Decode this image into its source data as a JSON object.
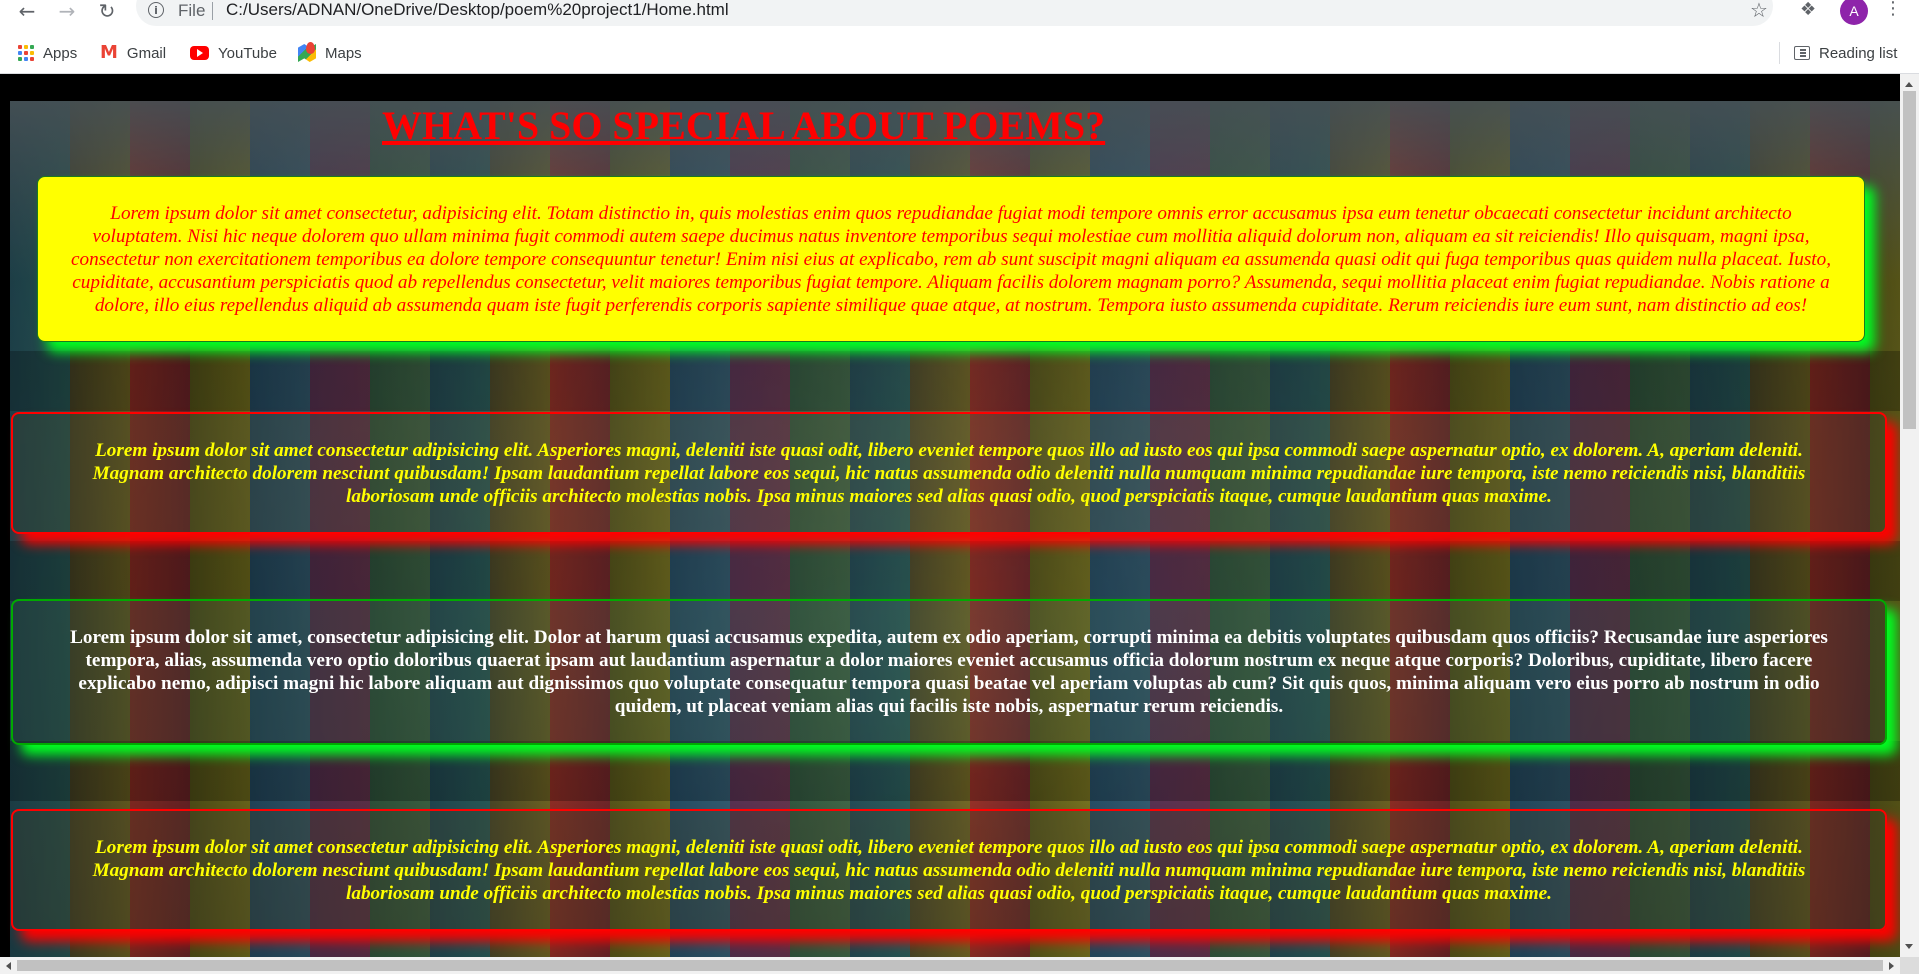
{
  "browser": {
    "scheme_label": "File",
    "url": "C:/Users/ADNAN/OneDrive/Desktop/poem%20project1/Home.html",
    "profile_initial": "A",
    "icons": {
      "back": "arrow-left-icon",
      "forward": "arrow-right-icon",
      "reload": "reload-icon",
      "info": "info-icon",
      "bookmark_star": "star-icon",
      "extensions": "puzzle-icon",
      "menu": "kebab-menu-icon"
    }
  },
  "bookmarks": {
    "apps": "Apps",
    "gmail": "Gmail",
    "youtube": "YouTube",
    "maps": "Maps",
    "reading_list": "Reading list"
  },
  "page": {
    "title": "WHAT'S SO SPECIAL ABOUT POEMS?",
    "colors": {
      "title": "#ff0000",
      "box1_bg": "#ffff00",
      "box1_text": "#ff0000",
      "green_glow": "#00ff22",
      "red_glow": "#ff0000",
      "yellow_text": "#ffff00",
      "white_text": "#ffffff"
    },
    "boxes": [
      {
        "text": "Lorem ipsum dolor sit amet consectetur, adipisicing elit. Totam distinctio in, quis molestias enim quos repudiandae fugiat modi tempore omnis error accusamus ipsa eum tenetur obcaecati consectetur incidunt architecto voluptatem. Nisi hic neque dolorem quo ullam minima fugit commodi autem saepe ducimus natus inventore temporibus sequi molestiae cum mollitia aliquid dolorum non, aliquam ea sit reiciendis! Illo quisquam, magni ipsa, consectetur non exercitationem temporibus ea dolore tempore consequuntur tenetur! Enim nisi eius at explicabo, rem ab sunt suscipit magni aliquam ea assumenda quasi odit qui fuga temporibus quas quidem nulla placeat. Iusto, cupiditate, accusantium perspiciatis quod ab repellendus consectetur, velit maiores temporibus fugiat tempore. Aliquam facilis dolorem magnam porro? Assumenda, sequi mollitia placeat enim fugiat repudiandae. Nobis ratione a dolore, illo eius repellendus aliquid ab assumenda quam iste fugit perferendis corporis sapiente similique quae atque, at nostrum. Tempora iusto assumenda cupiditate. Rerum reiciendis iure eum sunt, nam distinctio ad eos!"
      },
      {
        "text": "Lorem ipsum dolor sit amet consectetur adipisicing elit. Asperiores magni, deleniti iste quasi odit, libero eveniet tempore quos illo ad iusto eos qui ipsa commodi saepe aspernatur optio, ex dolorem. A, aperiam deleniti. Magnam architecto dolorem nesciunt quibusdam! Ipsam laudantium repellat labore eos sequi, hic natus assumenda odio deleniti nulla numquam minima repudiandae iure tempora, iste nemo reiciendis nisi, blanditiis laboriosam unde officiis architecto molestias nobis. Ipsa minus maiores sed alias quasi odio, quod perspiciatis itaque, cumque laudantium quas maxime."
      },
      {
        "text": "Lorem ipsum dolor sit amet, consectetur adipisicing elit. Dolor at harum quasi accusamus expedita, autem ex odio aperiam, corrupti minima ea debitis voluptates quibusdam quos officiis? Recusandae iure asperiores tempora, alias, assumenda vero optio doloribus quaerat ipsam aut laudantium aspernatur a dolor maiores eveniet accusamus officia dolorum nostrum ex neque atque corporis? Doloribus, cupiditate, libero facere explicabo nemo, adipisci magni hic labore aliquam aut dignissimos quo voluptate consequatur tempora quasi beatae vel aperiam voluptas ab cum? Sit quis quos, minima aliquam vero eius porro ab nostrum in odio quidem, ut placeat veniam alias qui facilis iste nobis, aspernatur rerum reiciendis."
      },
      {
        "text": "Lorem ipsum dolor sit amet consectetur adipisicing elit. Asperiores magni, deleniti iste quasi odit, libero eveniet tempore quos illo ad iusto eos qui ipsa commodi saepe aspernatur optio, ex dolorem. A, aperiam deleniti. Magnam architecto dolorem nesciunt quibusdam! Ipsam laudantium repellat labore eos sequi, hic natus assumenda odio deleniti nulla numquam minima repudiandae iure tempora, iste nemo reiciendis nisi, blanditiis laboriosam unde officiis architecto molestias nobis. Ipsa minus maiores sed alias quasi odio, quod perspiciatis itaque, cumque laudantium quas maxime."
      }
    ]
  }
}
